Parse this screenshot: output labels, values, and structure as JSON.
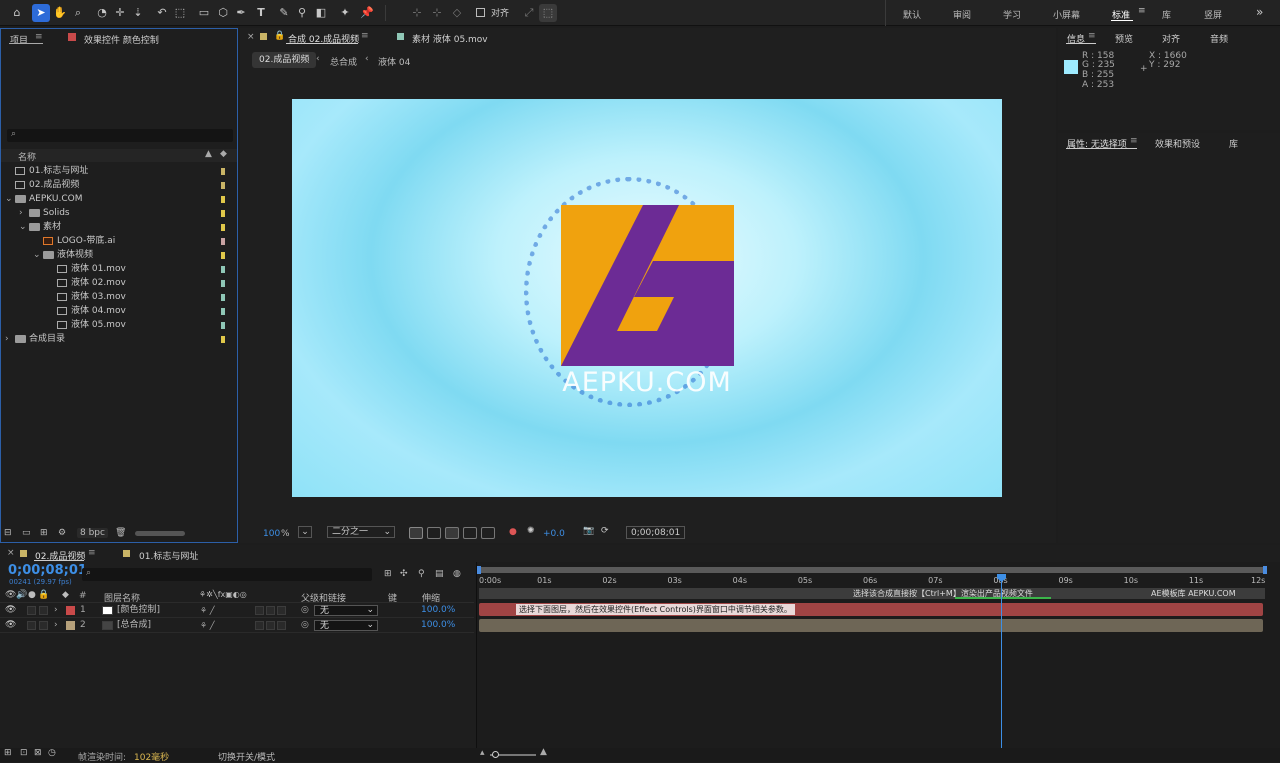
{
  "toolbar": {
    "snap_label": "对齐",
    "workspaces": [
      "默认",
      "审阅",
      "学习",
      "小屏幕",
      "标准",
      "库",
      "竖屏"
    ],
    "active_workspace": "标准",
    "more_icon": "»"
  },
  "project_panel": {
    "tab_project": "项目",
    "tab_effects": "效果控件 颜色控制",
    "search_placeholder": "",
    "col_name": "名称",
    "items": [
      {
        "label": "01.标志与网址",
        "indent": 0,
        "kind": "comp",
        "tag": "#c9b466"
      },
      {
        "label": "02.成品视频",
        "indent": 0,
        "kind": "comp",
        "tag": "#c9b466"
      },
      {
        "label": "AEPKU.COM",
        "indent": 0,
        "kind": "folder-open",
        "tag": "#e0c84a"
      },
      {
        "label": "Solids",
        "indent": 1,
        "kind": "folder",
        "tag": "#e0c84a"
      },
      {
        "label": "素材",
        "indent": 1,
        "kind": "folder-open",
        "tag": "#e0c84a"
      },
      {
        "label": "LOGO-带底.ai",
        "indent": 2,
        "kind": "ai",
        "tag": "#c9a3a3"
      },
      {
        "label": "液体视频",
        "indent": 2,
        "kind": "folder-open",
        "tag": "#e0c84a"
      },
      {
        "label": "液体 01.mov",
        "indent": 3,
        "kind": "file",
        "tag": "#8fc7b6"
      },
      {
        "label": "液体 02.mov",
        "indent": 3,
        "kind": "file",
        "tag": "#8fc7b6"
      },
      {
        "label": "液体 03.mov",
        "indent": 3,
        "kind": "file",
        "tag": "#8fc7b6"
      },
      {
        "label": "液体 04.mov",
        "indent": 3,
        "kind": "file",
        "tag": "#8fc7b6"
      },
      {
        "label": "液体 05.mov",
        "indent": 3,
        "kind": "file",
        "tag": "#8fc7b6"
      },
      {
        "label": "合成目录",
        "indent": 0,
        "kind": "folder",
        "tag": "#e0c84a"
      }
    ],
    "bpc": "8 bpc"
  },
  "comp_panel": {
    "tab_comp": "合成 02.成品视频",
    "tab_footage": "素材 液体 05.mov",
    "breadcrumbs": [
      "02.成品视频",
      "总合成",
      "液体 04"
    ],
    "logo_text": "AEPKU.COM",
    "zoom": "100",
    "zoom_unit": "%",
    "resolution": "二分之一",
    "exposure": "+0.0",
    "timecode": "0;00;08;01"
  },
  "info_panel": {
    "tabs": [
      "信息",
      "预览",
      "对齐",
      "音频"
    ],
    "r": "R : 158",
    "g": "G : 235",
    "b": "B : 255",
    "a": "A : 253",
    "x": "X : 1660",
    "y": "Y : 292",
    "swatch": "#9eebff"
  },
  "properties_panel": {
    "tabs": [
      "属性: 无选择项",
      "效果和预设",
      "库"
    ]
  },
  "timeline": {
    "tabs": [
      "02.成品视频",
      "01.标志与网址"
    ],
    "timecode": "0;00;08;01",
    "frames": "00241 (29.97 fps)",
    "headers": {
      "source": "图层名称",
      "parent": "父级和链接",
      "keys": "键",
      "stretch": "伸缩",
      "hash": "#"
    },
    "ruler": [
      "0:00s",
      "01s",
      "02s",
      "03s",
      "04s",
      "05s",
      "06s",
      "07s",
      "08s",
      "09s",
      "10s",
      "11s",
      "12s"
    ],
    "markers": [
      "选择该合成直接按【Ctrl+M】渲染出产品视频文件",
      "AE模板库 AEPKU.COM"
    ],
    "comment": "选择下面图层，然后在效果控件(Effect Controls)界面窗口中调节相关参数。",
    "layers": [
      {
        "num": "1",
        "name": "[颜色控制]",
        "parent": "无",
        "stretch": "100.0%",
        "color": "#c94a4a"
      },
      {
        "num": "2",
        "name": "[总合成]",
        "parent": "无",
        "stretch": "100.0%",
        "color": "#b5a07a"
      }
    ],
    "render_time_label": "帧渲染时间:",
    "render_time_value": "102毫秒",
    "toggle_label": "切换开关/模式"
  }
}
